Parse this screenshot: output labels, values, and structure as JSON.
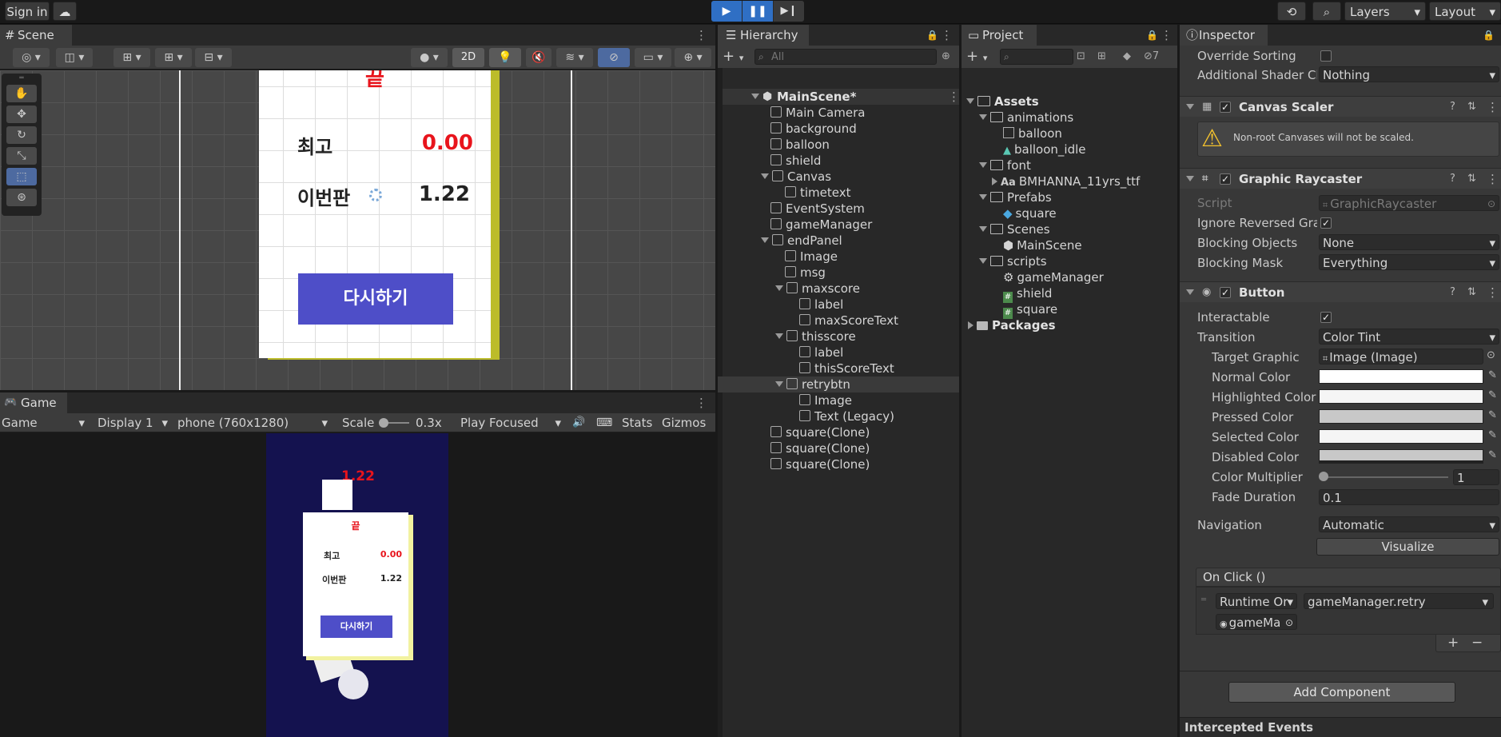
{
  "topbar": {
    "sign_in": "Sign in",
    "layers": "Layers",
    "layout": "Layout"
  },
  "scene": {
    "tab": "Scene",
    "mode_2d": "2D",
    "panel": {
      "title": "끝",
      "best_label": "최고",
      "best_value": "0.00",
      "this_label": "이번판",
      "this_value": "1.22",
      "retry": "다시하기"
    }
  },
  "game": {
    "tab": "Game",
    "mode": "Game",
    "display": "Display 1",
    "resolution": "phone (760x1280)",
    "scale_label": "Scale",
    "scale_value": "0.3x",
    "play_focused": "Play Focused",
    "stats": "Stats",
    "gizmos": "Gizmos",
    "timer": "1.22",
    "panel": {
      "title": "끝",
      "best_label": "최고",
      "best_value": "0.00",
      "this_label": "이번판",
      "this_value": "1.22",
      "retry": "다시하기"
    },
    "colors": {
      "background": "#14124f",
      "accent": "#e8141c",
      "button": "#4e4ec8"
    }
  },
  "hierarchy": {
    "tab": "Hierarchy",
    "search_placeholder": "All",
    "items": [
      {
        "label": "MainScene*"
      },
      {
        "label": "Main Camera"
      },
      {
        "label": "background"
      },
      {
        "label": "balloon"
      },
      {
        "label": "shield"
      },
      {
        "label": "Canvas"
      },
      {
        "label": "timetext"
      },
      {
        "label": "EventSystem"
      },
      {
        "label": "gameManager"
      },
      {
        "label": "endPanel"
      },
      {
        "label": "Image"
      },
      {
        "label": "msg"
      },
      {
        "label": "maxscore"
      },
      {
        "label": "label"
      },
      {
        "label": "maxScoreText"
      },
      {
        "label": "thisscore"
      },
      {
        "label": "label"
      },
      {
        "label": "thisScoreText"
      },
      {
        "label": "retrybtn"
      },
      {
        "label": "Image"
      },
      {
        "label": "Text (Legacy)"
      },
      {
        "label": "square(Clone)"
      },
      {
        "label": "square(Clone)"
      },
      {
        "label": "square(Clone)"
      }
    ]
  },
  "project": {
    "tab": "Project",
    "hidden_count": "7",
    "items": [
      {
        "label": "Assets"
      },
      {
        "label": "animations"
      },
      {
        "label": "balloon"
      },
      {
        "label": "balloon_idle"
      },
      {
        "label": "font"
      },
      {
        "label": "BMHANNA_11yrs_ttf"
      },
      {
        "label": "Prefabs"
      },
      {
        "label": "square"
      },
      {
        "label": "Scenes"
      },
      {
        "label": "MainScene"
      },
      {
        "label": "scripts"
      },
      {
        "label": "gameManager"
      },
      {
        "label": "shield"
      },
      {
        "label": "square"
      },
      {
        "label": "Packages"
      }
    ],
    "font_icon": "Aa"
  },
  "inspector": {
    "tab": "Inspector",
    "override_sorting": "Override Sorting",
    "additional_shader": "Additional Shader Ch",
    "additional_shader_value": "Nothing",
    "canvas_scaler": "Canvas Scaler",
    "canvas_warning": "Non-root Canvases will not be scaled.",
    "graphic_raycaster": "Graphic Raycaster",
    "script_label": "Script",
    "script_value": "GraphicRaycaster",
    "ignore_reversed": "Ignore Reversed Gra",
    "blocking_objects": "Blocking Objects",
    "blocking_objects_value": "None",
    "blocking_mask": "Blocking Mask",
    "blocking_mask_value": "Everything",
    "button": "Button",
    "interactable": "Interactable",
    "transition": "Transition",
    "transition_value": "Color Tint",
    "target_graphic": "Target Graphic",
    "target_graphic_value": "Image (Image)",
    "normal_color": "Normal Color",
    "highlighted_color": "Highlighted Color",
    "pressed_color": "Pressed Color",
    "selected_color": "Selected Color",
    "disabled_color": "Disabled Color",
    "color_multiplier": "Color Multiplier",
    "color_multiplier_value": "1",
    "color_multiplier_fraction": 0,
    "fade_duration": "Fade Duration",
    "fade_duration_value": "0.1",
    "navigation": "Navigation",
    "navigation_value": "Automatic",
    "visualize": "Visualize",
    "on_click": "On Click ()",
    "runtime": "Runtime Or",
    "method": "gameManager.retry",
    "object": "gameMa",
    "add_component": "Add Component",
    "intercepted_events": "Intercepted Events"
  }
}
